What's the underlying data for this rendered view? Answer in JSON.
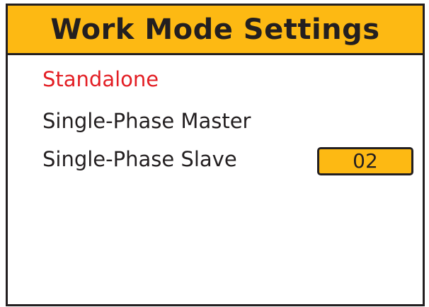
{
  "header": {
    "title": "Work Mode Settings"
  },
  "menu": {
    "selected_index": 0,
    "items": [
      {
        "label": "Standalone"
      },
      {
        "label": "Single-Phase Master"
      },
      {
        "label": "Single-Phase Slave"
      }
    ]
  },
  "slave_address": {
    "value": "02"
  },
  "colors": {
    "header_background": "#fdb913",
    "selected_text": "#e31e24",
    "text": "#231f20",
    "border": "#231f20",
    "value_box_background": "#fdb913"
  }
}
